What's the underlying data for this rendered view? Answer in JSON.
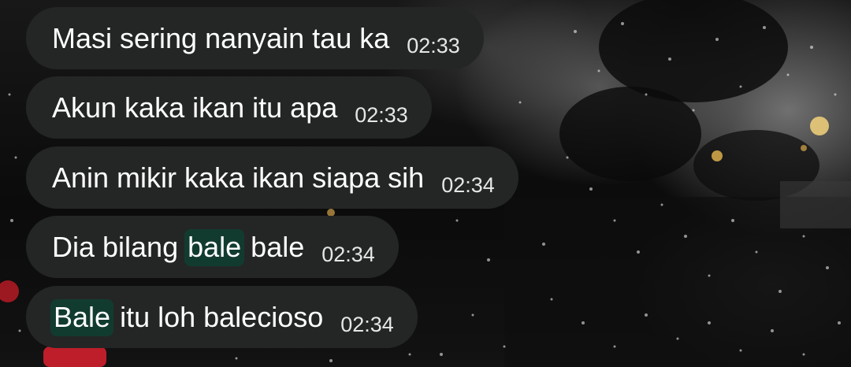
{
  "messages": [
    {
      "text": "Masi sering nanyain tau ka",
      "time": "02:33"
    },
    {
      "text": "Akun kaka ikan itu apa",
      "time": "02:33"
    },
    {
      "text": "Anin mikir kaka ikan siapa sih",
      "time": "02:34"
    },
    {
      "before": "Dia bilang ",
      "highlight": "bale",
      "after": " bale",
      "time": "02:34"
    },
    {
      "before": "",
      "highlight": "Bale",
      "after": " itu loh balecioso",
      "time": "02:34"
    }
  ],
  "colors": {
    "bubble": "#242626",
    "highlight": "#123b30",
    "text": "#ffffff",
    "timestamp": "#e6e6e6"
  }
}
